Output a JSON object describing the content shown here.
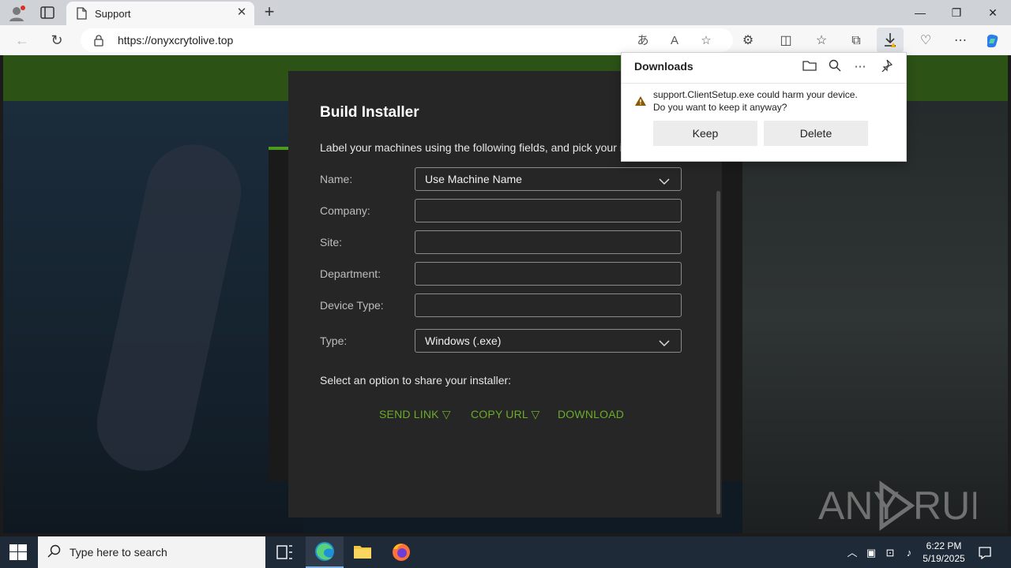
{
  "browser": {
    "tab_title": "Support",
    "url": "https://onyxcrytolive.top"
  },
  "downloads": {
    "title": "Downloads",
    "warning_line1": "support.ClientSetup.exe could harm your device.",
    "warning_line2": "Do you want to keep it anyway?",
    "keep_label": "Keep",
    "delete_label": "Delete"
  },
  "modal": {
    "title": "Build Installer",
    "description": "Label your machines using the following fields, and pick your i",
    "fields": [
      {
        "label": "Name:",
        "value": "Use Machine Name"
      },
      {
        "label": "Company:",
        "value": ""
      },
      {
        "label": "Site:",
        "value": ""
      },
      {
        "label": "Department:",
        "value": ""
      },
      {
        "label": "Device Type:",
        "value": ""
      },
      {
        "label": "Type:",
        "value": "Windows (.exe)"
      }
    ],
    "share_prompt": "Select an option to share your installer:",
    "send_link": "SEND LINK ▽",
    "copy_url": "COPY URL ▽",
    "download": "DOWNLOAD"
  },
  "watermark": "ANY RUN",
  "taskbar": {
    "search_placeholder": "Type here to search",
    "time": "6:22 PM",
    "date": "5/19/2025"
  },
  "colors": {
    "accent_green": "#6aac2a",
    "band_green": "#2c5216",
    "modal_bg": "#262626"
  }
}
